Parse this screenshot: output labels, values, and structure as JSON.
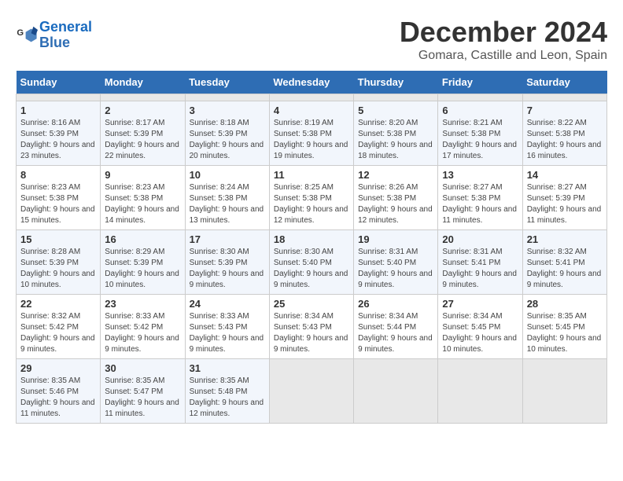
{
  "header": {
    "logo_line1": "General",
    "logo_line2": "Blue",
    "title": "December 2024",
    "subtitle": "Gomara, Castille and Leon, Spain"
  },
  "calendar": {
    "headers": [
      "Sunday",
      "Monday",
      "Tuesday",
      "Wednesday",
      "Thursday",
      "Friday",
      "Saturday"
    ],
    "weeks": [
      [
        {
          "day": "",
          "sunrise": "",
          "sunset": "",
          "daylight": "",
          "empty": true
        },
        {
          "day": "",
          "sunrise": "",
          "sunset": "",
          "daylight": "",
          "empty": true
        },
        {
          "day": "",
          "sunrise": "",
          "sunset": "",
          "daylight": "",
          "empty": true
        },
        {
          "day": "",
          "sunrise": "",
          "sunset": "",
          "daylight": "",
          "empty": true
        },
        {
          "day": "",
          "sunrise": "",
          "sunset": "",
          "daylight": "",
          "empty": true
        },
        {
          "day": "",
          "sunrise": "",
          "sunset": "",
          "daylight": "",
          "empty": true
        },
        {
          "day": "",
          "sunrise": "",
          "sunset": "",
          "daylight": "",
          "empty": true
        }
      ],
      [
        {
          "day": "1",
          "sunrise": "Sunrise: 8:16 AM",
          "sunset": "Sunset: 5:39 PM",
          "daylight": "Daylight: 9 hours and 23 minutes.",
          "empty": false
        },
        {
          "day": "2",
          "sunrise": "Sunrise: 8:17 AM",
          "sunset": "Sunset: 5:39 PM",
          "daylight": "Daylight: 9 hours and 22 minutes.",
          "empty": false
        },
        {
          "day": "3",
          "sunrise": "Sunrise: 8:18 AM",
          "sunset": "Sunset: 5:39 PM",
          "daylight": "Daylight: 9 hours and 20 minutes.",
          "empty": false
        },
        {
          "day": "4",
          "sunrise": "Sunrise: 8:19 AM",
          "sunset": "Sunset: 5:38 PM",
          "daylight": "Daylight: 9 hours and 19 minutes.",
          "empty": false
        },
        {
          "day": "5",
          "sunrise": "Sunrise: 8:20 AM",
          "sunset": "Sunset: 5:38 PM",
          "daylight": "Daylight: 9 hours and 18 minutes.",
          "empty": false
        },
        {
          "day": "6",
          "sunrise": "Sunrise: 8:21 AM",
          "sunset": "Sunset: 5:38 PM",
          "daylight": "Daylight: 9 hours and 17 minutes.",
          "empty": false
        },
        {
          "day": "7",
          "sunrise": "Sunrise: 8:22 AM",
          "sunset": "Sunset: 5:38 PM",
          "daylight": "Daylight: 9 hours and 16 minutes.",
          "empty": false
        }
      ],
      [
        {
          "day": "8",
          "sunrise": "Sunrise: 8:23 AM",
          "sunset": "Sunset: 5:38 PM",
          "daylight": "Daylight: 9 hours and 15 minutes.",
          "empty": false
        },
        {
          "day": "9",
          "sunrise": "Sunrise: 8:23 AM",
          "sunset": "Sunset: 5:38 PM",
          "daylight": "Daylight: 9 hours and 14 minutes.",
          "empty": false
        },
        {
          "day": "10",
          "sunrise": "Sunrise: 8:24 AM",
          "sunset": "Sunset: 5:38 PM",
          "daylight": "Daylight: 9 hours and 13 minutes.",
          "empty": false
        },
        {
          "day": "11",
          "sunrise": "Sunrise: 8:25 AM",
          "sunset": "Sunset: 5:38 PM",
          "daylight": "Daylight: 9 hours and 12 minutes.",
          "empty": false
        },
        {
          "day": "12",
          "sunrise": "Sunrise: 8:26 AM",
          "sunset": "Sunset: 5:38 PM",
          "daylight": "Daylight: 9 hours and 12 minutes.",
          "empty": false
        },
        {
          "day": "13",
          "sunrise": "Sunrise: 8:27 AM",
          "sunset": "Sunset: 5:38 PM",
          "daylight": "Daylight: 9 hours and 11 minutes.",
          "empty": false
        },
        {
          "day": "14",
          "sunrise": "Sunrise: 8:27 AM",
          "sunset": "Sunset: 5:39 PM",
          "daylight": "Daylight: 9 hours and 11 minutes.",
          "empty": false
        }
      ],
      [
        {
          "day": "15",
          "sunrise": "Sunrise: 8:28 AM",
          "sunset": "Sunset: 5:39 PM",
          "daylight": "Daylight: 9 hours and 10 minutes.",
          "empty": false
        },
        {
          "day": "16",
          "sunrise": "Sunrise: 8:29 AM",
          "sunset": "Sunset: 5:39 PM",
          "daylight": "Daylight: 9 hours and 10 minutes.",
          "empty": false
        },
        {
          "day": "17",
          "sunrise": "Sunrise: 8:30 AM",
          "sunset": "Sunset: 5:39 PM",
          "daylight": "Daylight: 9 hours and 9 minutes.",
          "empty": false
        },
        {
          "day": "18",
          "sunrise": "Sunrise: 8:30 AM",
          "sunset": "Sunset: 5:40 PM",
          "daylight": "Daylight: 9 hours and 9 minutes.",
          "empty": false
        },
        {
          "day": "19",
          "sunrise": "Sunrise: 8:31 AM",
          "sunset": "Sunset: 5:40 PM",
          "daylight": "Daylight: 9 hours and 9 minutes.",
          "empty": false
        },
        {
          "day": "20",
          "sunrise": "Sunrise: 8:31 AM",
          "sunset": "Sunset: 5:41 PM",
          "daylight": "Daylight: 9 hours and 9 minutes.",
          "empty": false
        },
        {
          "day": "21",
          "sunrise": "Sunrise: 8:32 AM",
          "sunset": "Sunset: 5:41 PM",
          "daylight": "Daylight: 9 hours and 9 minutes.",
          "empty": false
        }
      ],
      [
        {
          "day": "22",
          "sunrise": "Sunrise: 8:32 AM",
          "sunset": "Sunset: 5:42 PM",
          "daylight": "Daylight: 9 hours and 9 minutes.",
          "empty": false
        },
        {
          "day": "23",
          "sunrise": "Sunrise: 8:33 AM",
          "sunset": "Sunset: 5:42 PM",
          "daylight": "Daylight: 9 hours and 9 minutes.",
          "empty": false
        },
        {
          "day": "24",
          "sunrise": "Sunrise: 8:33 AM",
          "sunset": "Sunset: 5:43 PM",
          "daylight": "Daylight: 9 hours and 9 minutes.",
          "empty": false
        },
        {
          "day": "25",
          "sunrise": "Sunrise: 8:34 AM",
          "sunset": "Sunset: 5:43 PM",
          "daylight": "Daylight: 9 hours and 9 minutes.",
          "empty": false
        },
        {
          "day": "26",
          "sunrise": "Sunrise: 8:34 AM",
          "sunset": "Sunset: 5:44 PM",
          "daylight": "Daylight: 9 hours and 9 minutes.",
          "empty": false
        },
        {
          "day": "27",
          "sunrise": "Sunrise: 8:34 AM",
          "sunset": "Sunset: 5:45 PM",
          "daylight": "Daylight: 9 hours and 10 minutes.",
          "empty": false
        },
        {
          "day": "28",
          "sunrise": "Sunrise: 8:35 AM",
          "sunset": "Sunset: 5:45 PM",
          "daylight": "Daylight: 9 hours and 10 minutes.",
          "empty": false
        }
      ],
      [
        {
          "day": "29",
          "sunrise": "Sunrise: 8:35 AM",
          "sunset": "Sunset: 5:46 PM",
          "daylight": "Daylight: 9 hours and 11 minutes.",
          "empty": false
        },
        {
          "day": "30",
          "sunrise": "Sunrise: 8:35 AM",
          "sunset": "Sunset: 5:47 PM",
          "daylight": "Daylight: 9 hours and 11 minutes.",
          "empty": false
        },
        {
          "day": "31",
          "sunrise": "Sunrise: 8:35 AM",
          "sunset": "Sunset: 5:48 PM",
          "daylight": "Daylight: 9 hours and 12 minutes.",
          "empty": false
        },
        {
          "day": "",
          "sunrise": "",
          "sunset": "",
          "daylight": "",
          "empty": true
        },
        {
          "day": "",
          "sunrise": "",
          "sunset": "",
          "daylight": "",
          "empty": true
        },
        {
          "day": "",
          "sunrise": "",
          "sunset": "",
          "daylight": "",
          "empty": true
        },
        {
          "day": "",
          "sunrise": "",
          "sunset": "",
          "daylight": "",
          "empty": true
        }
      ]
    ]
  }
}
